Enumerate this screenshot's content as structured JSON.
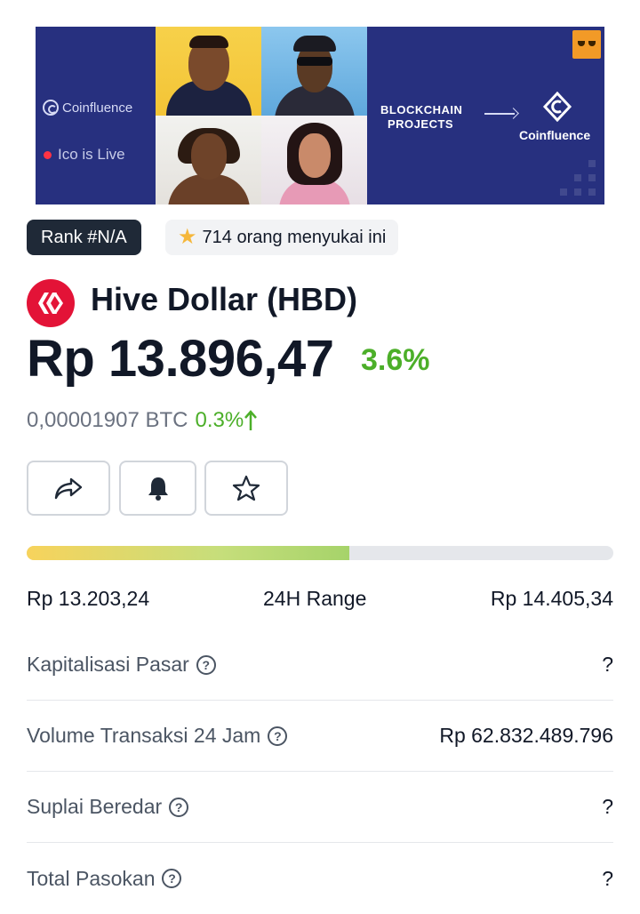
{
  "banner": {
    "brand_name": "Coinfluence",
    "ico_status": "Ico is Live",
    "headline_line1": "BLOCKCHAIN",
    "headline_line2": "PROJECTS",
    "cta_brand": "Coinfluence",
    "accent_color": "#27307f"
  },
  "rank": {
    "label": "Rank #N/A",
    "likes": "714 orang menyukai ini",
    "like_icon": "star-icon"
  },
  "coin": {
    "name": "Hive Dollar (HBD)",
    "logo_color": "#e31337",
    "price": "Rp 13.896,47",
    "change": "3.6%",
    "btc_price": "0,00001907 BTC",
    "btc_change": "0.3%",
    "positive_color": "#4caf29"
  },
  "actions": {
    "share_icon": "share-icon",
    "alert_icon": "bell-icon",
    "favorite_icon": "star-outline-icon"
  },
  "range": {
    "low": "Rp 13.203,24",
    "title": "24H Range",
    "high": "Rp 14.405,34",
    "position_fraction": 0.55
  },
  "stats": [
    {
      "label": "Kapitalisasi Pasar",
      "value": "?"
    },
    {
      "label": "Volume Transaksi 24 Jam",
      "value": "Rp 62.832.489.796"
    },
    {
      "label": "Suplai Beredar",
      "value": "?"
    },
    {
      "label": "Total Pasokan",
      "value": "?"
    }
  ]
}
